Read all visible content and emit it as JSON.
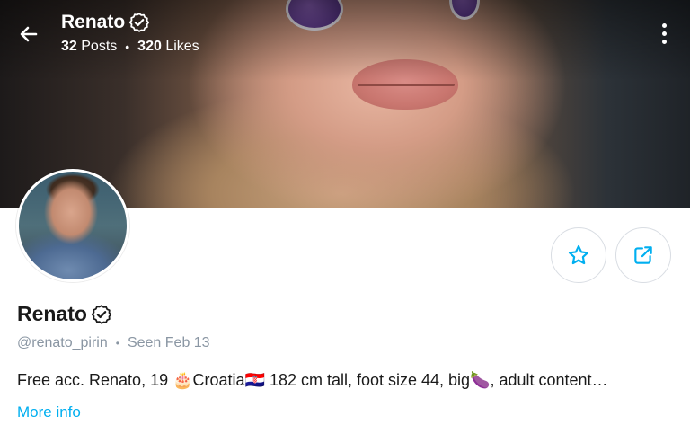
{
  "header": {
    "name": "Renato",
    "posts_count": "32",
    "posts_label": "Posts",
    "separator": "•",
    "likes_count": "320",
    "likes_label": "Likes"
  },
  "profile": {
    "name": "Renato",
    "username": "@renato_pirin",
    "meta_separator": "•",
    "last_seen": "Seen Feb 13",
    "bio": "Free acc. Renato, 19 🎂Croatia🇭🇷 182 cm tall, foot size 44, big🍆, adult content…",
    "more_info_label": "More info"
  },
  "icons": {
    "back": "arrow-left-icon",
    "verified": "verified-badge-icon",
    "more": "more-vertical-icon",
    "favorite": "star-icon",
    "share": "share-icon"
  },
  "colors": {
    "accent": "#00aff0",
    "muted_text": "#8a96a3",
    "primary_text": "#1a1a1a"
  }
}
